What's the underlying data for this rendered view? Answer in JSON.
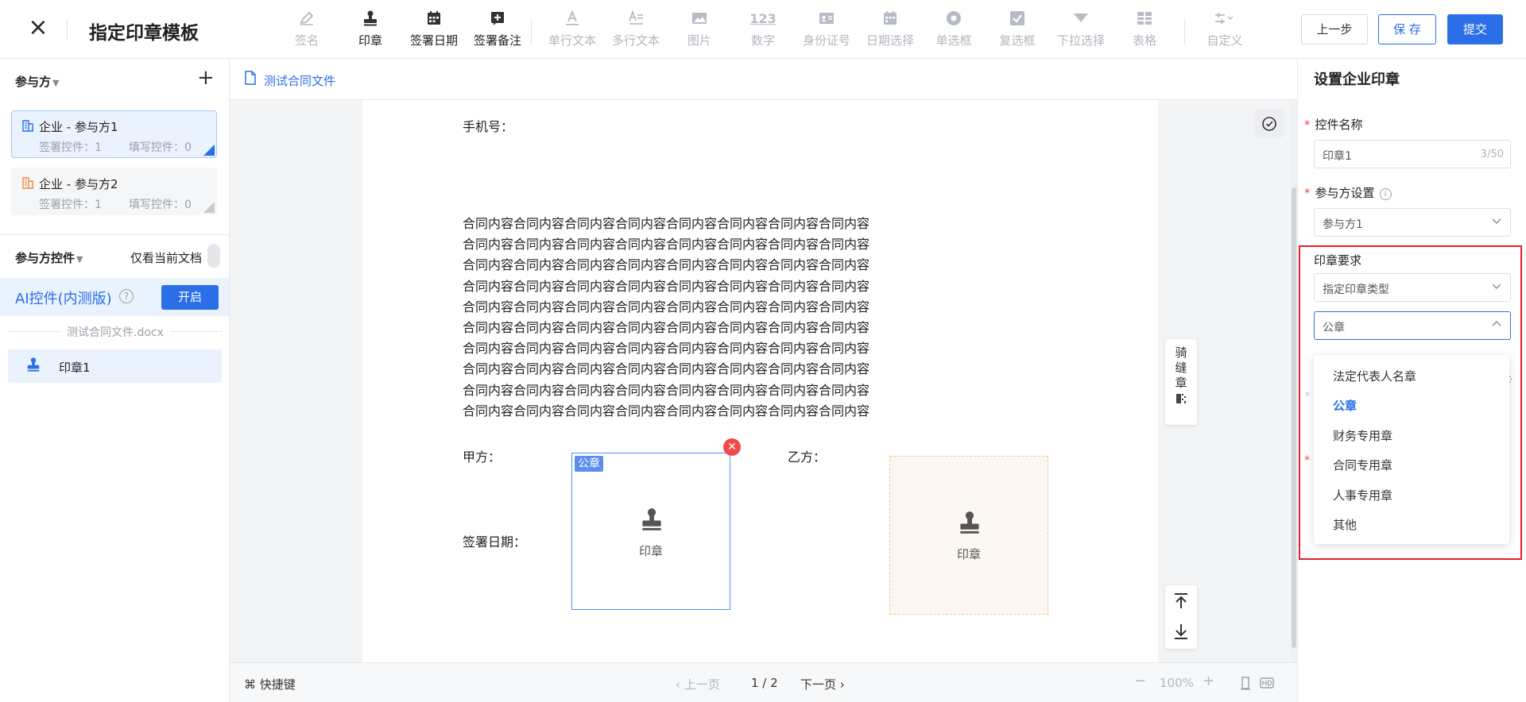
{
  "header": {
    "title": "指定印章模板",
    "toolbar": [
      {
        "label": "签名",
        "icon": "pen-icon",
        "enabled": false
      },
      {
        "label": "印章",
        "icon": "stamp-icon",
        "enabled": true
      },
      {
        "label": "签署日期",
        "icon": "calendar-icon",
        "enabled": true
      },
      {
        "label": "签署备注",
        "icon": "add-note-icon",
        "enabled": true
      },
      {
        "label": "单行文本",
        "icon": "single-line-text-icon",
        "enabled": false
      },
      {
        "label": "多行文本",
        "icon": "multi-line-text-icon",
        "enabled": false
      },
      {
        "label": "图片",
        "icon": "image-icon",
        "enabled": false
      },
      {
        "label": "数字",
        "icon": "number-icon",
        "enabled": false
      },
      {
        "label": "身份证号",
        "icon": "id-card-icon",
        "enabled": false
      },
      {
        "label": "日期选择",
        "icon": "date-picker-icon",
        "enabled": false
      },
      {
        "label": "单选框",
        "icon": "radio-icon",
        "enabled": false
      },
      {
        "label": "复选框",
        "icon": "checkbox-icon",
        "enabled": false
      },
      {
        "label": "下拉选择",
        "icon": "dropdown-icon",
        "enabled": false
      },
      {
        "label": "表格",
        "icon": "table-icon",
        "enabled": false
      },
      {
        "label": "自定义",
        "icon": "custom-settings-icon",
        "enabled": false
      }
    ],
    "number_icon_text": "123",
    "buttons": {
      "prev": "上一步",
      "save": "保 存",
      "submit": "提交"
    }
  },
  "left": {
    "parties_title": "参与方",
    "parties": [
      {
        "name": "企业 - 参与方1",
        "sign_count": "签署控件：1",
        "fill_count": "填写控件：0",
        "color": "#2a6ee8"
      },
      {
        "name": "企业 - 参与方2",
        "sign_count": "签署控件：1",
        "fill_count": "填写控件：0",
        "color": "#f08a3c"
      }
    ],
    "controls_title": "参与方控件",
    "only_current_doc": "仅看当前文档",
    "ai_label": "AI控件(内测版)",
    "ai_help": "?",
    "ai_button": "开启",
    "doc_name": "测试合同文件.docx",
    "control_item": "印章1"
  },
  "center": {
    "doc_tab": "测试合同文件",
    "phone_label": "手机号：",
    "paragraph_lines": [
      "合同内容合同内容合同内容合同内容合同内容合同内容合同内容合同内容",
      "合同内容合同内容合同内容合同内容合同内容合同内容合同内容合同内容",
      "合同内容合同内容合同内容合同内容合同内容合同内容合同内容合同内容",
      "合同内容合同内容合同内容合同内容合同内容合同内容合同内容合同内容",
      "合同内容合同内容合同内容合同内容合同内容合同内容合同内容合同内容",
      "合同内容合同内容合同内容合同内容合同内容合同内容合同内容合同内容",
      "合同内容合同内容合同内容合同内容合同内容合同内容合同内容合同内容",
      "合同内容合同内容合同内容合同内容合同内容合同内容合同内容合同内容",
      "合同内容合同内容合同内容合同内容合同内容合同内容合同内容合同内容",
      "合同内容合同内容合同内容合同内容合同内容合同内容合同内容合同内容"
    ],
    "party_a_label": "甲方：",
    "party_b_label": "乙方：",
    "sign_date_label": "签署日期：",
    "seal_a_tag": "公章",
    "seal_label": "印章",
    "riding_seal": "骑缝章",
    "bottom": {
      "shortcuts": "快捷键",
      "prev_page": "上一页",
      "page_indicator": "1 / 2",
      "next_page": "下一页",
      "zoom_out": "−",
      "zoom": "100%",
      "zoom_in": "+"
    }
  },
  "right": {
    "title": "设置企业印章",
    "control_name_label": "控件名称",
    "control_name_value": "印章1",
    "control_name_count": "3/50",
    "party_label": "参与方设置",
    "party_value": "参与方1",
    "seal_req_label": "印章要求",
    "seal_req_value": "指定印章类型",
    "seal_type_value": "公章",
    "dropdown_options": [
      "法定代表人名章",
      "公章",
      "财务专用章",
      "合同专用章",
      "人事专用章",
      "其他"
    ],
    "selected_option": "公章",
    "accent": "#2a6ee8",
    "highlight_color": "#e8202a"
  }
}
